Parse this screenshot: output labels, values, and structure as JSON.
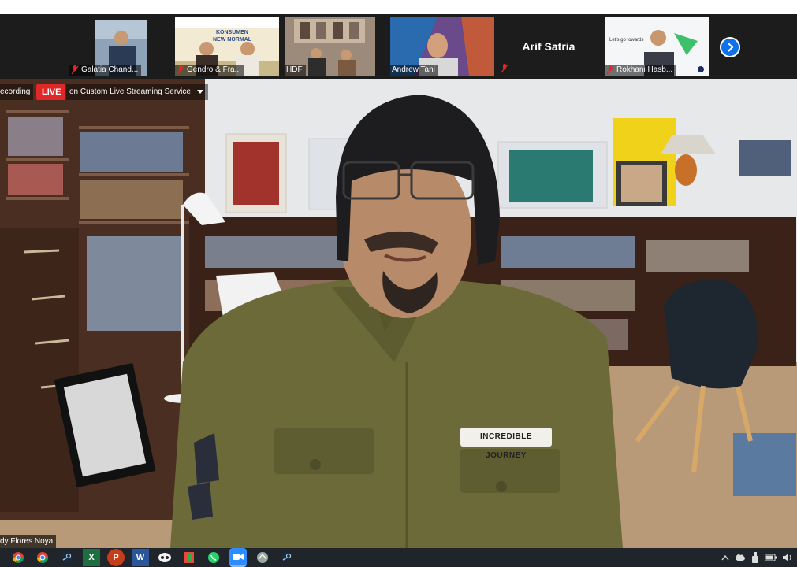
{
  "participants": [
    {
      "name": "Galatia Chand...",
      "muted": true
    },
    {
      "name": "Gendro & Fra...",
      "muted": true
    },
    {
      "name": "HDF",
      "muted": false
    },
    {
      "name": "Andrew Tani",
      "muted": false
    },
    {
      "name": "Arif Satria",
      "muted": true,
      "video": false
    },
    {
      "name": "Rokhani Hasb...",
      "muted": true
    }
  ],
  "thumb_texts": {
    "poster_line1": "KONSUMEN",
    "poster_line2": "NEW NORMAL",
    "slide_title": "Let's go towards"
  },
  "recording": {
    "label": "ecording",
    "live": "LIVE",
    "service": "on Custom Live Streaming Service"
  },
  "speaker": {
    "name": "dy Flores Noya",
    "patch_text": "INCREDIBLE JOURNEY"
  },
  "colors": {
    "accent": "#0e71eb",
    "live": "#e02828",
    "shirt": "#6b6a38"
  },
  "taskbar": {
    "apps": [
      "chrome-icon",
      "chrome-icon",
      "steam-icon",
      "excel-icon",
      "powerpoint-icon",
      "word-icon",
      "app-icon",
      "app-icon",
      "whatsapp-icon",
      "zoom-icon",
      "app-icon",
      "steam-icon"
    ],
    "excel": "X",
    "powerpoint": "P",
    "word": "W"
  }
}
